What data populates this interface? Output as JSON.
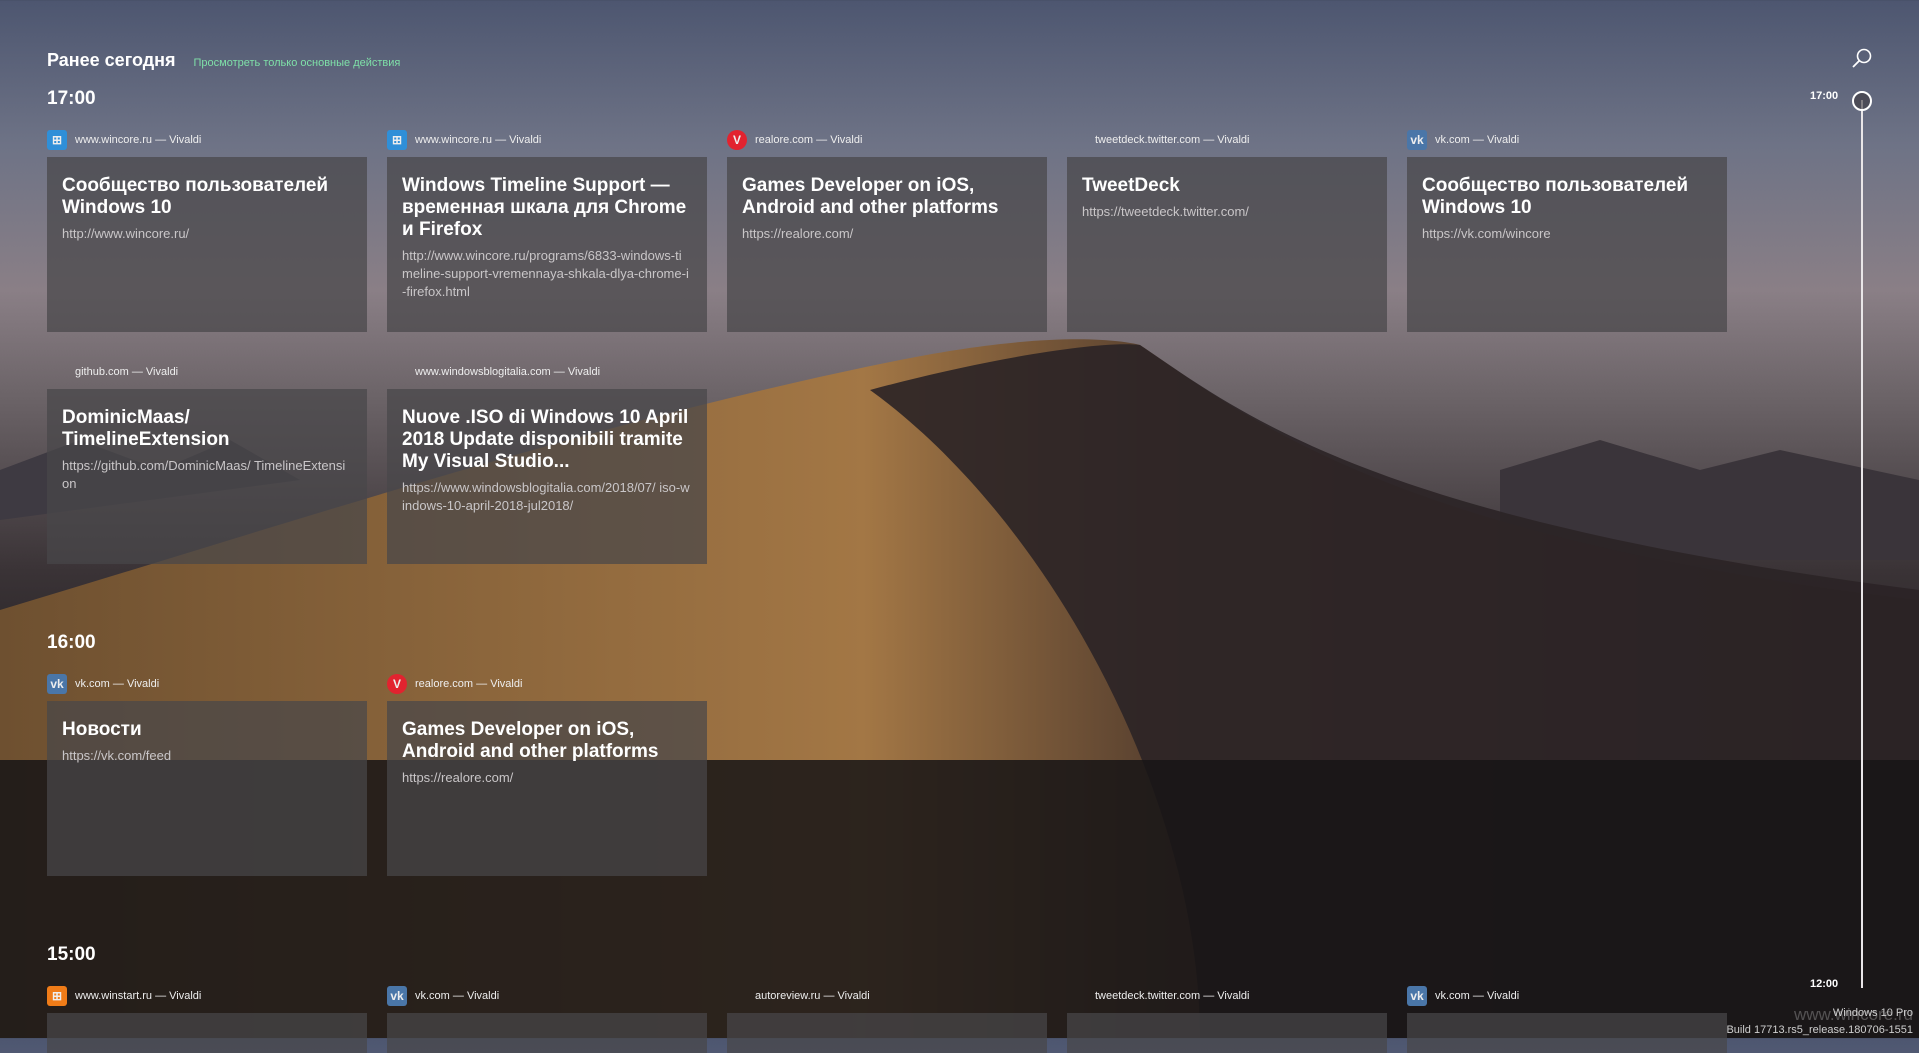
{
  "header": {
    "title": "Ранее сегодня",
    "filter_link": "Просмотреть только основные действия"
  },
  "sections": [
    {
      "time": "17:00"
    },
    {
      "time": "16:00"
    },
    {
      "time": "15:00"
    }
  ],
  "cards": [
    {
      "source": "www.wincore.ru — Vivaldi",
      "icon": "windows-grid-icon",
      "title": "Сообщество пользователей Windows 10",
      "url": "http://www.wincore.ru/"
    },
    {
      "source": "www.wincore.ru — Vivaldi",
      "icon": "windows-grid-icon",
      "title": "Windows Timeline Support — временная шкала для Chrome и Firefox",
      "url": "http://www.wincore.ru/programs/6833-windows-timeline-support-vremennaya-shkala-dlya-chrome-i-firefox.html"
    },
    {
      "source": "realore.com — Vivaldi",
      "icon": "vivaldi-icon",
      "title": "Games Developer on iOS, Android and other platforms",
      "url": "https://realore.com/"
    },
    {
      "source": "tweetdeck.twitter.com — Vivaldi",
      "icon": "blank-icon",
      "title": "TweetDeck",
      "url": "https://tweetdeck.twitter.com/"
    },
    {
      "source": "vk.com — Vivaldi",
      "icon": "vk-icon",
      "title": "Сообщество пользователей Windows 10",
      "url": "https://vk.com/wincore"
    },
    {
      "source": "github.com — Vivaldi",
      "icon": "blank-icon",
      "title": "DominicMaas/ TimelineExtension",
      "url": "https://github.com/DominicMaas/ TimelineExtension"
    },
    {
      "source": "www.windowsblogitalia.com — Vivaldi",
      "icon": "blank-icon",
      "title": "Nuove .ISO di Windows 10 April 2018 Update disponibili tramite My Visual Studio...",
      "url": "https://www.windowsblogitalia.com/2018/07/ iso-windows-10-april-2018-jul2018/"
    },
    {
      "source": "vk.com — Vivaldi",
      "icon": "vk-icon",
      "title": "Новости",
      "url": "https://vk.com/feed"
    },
    {
      "source": "realore.com — Vivaldi",
      "icon": "vivaldi-icon",
      "title": "Games Developer on iOS, Android and other platforms",
      "url": "https://realore.com/"
    },
    {
      "source": "www.winstart.ru — Vivaldi",
      "icon": "winstart-icon",
      "title": "",
      "url": ""
    },
    {
      "source": "vk.com — Vivaldi",
      "icon": "vk-icon",
      "title": "",
      "url": ""
    },
    {
      "source": "autoreview.ru — Vivaldi",
      "icon": "blank-icon",
      "title": "",
      "url": ""
    },
    {
      "source": "tweetdeck.twitter.com — Vivaldi",
      "icon": "blank-icon",
      "title": "",
      "url": ""
    },
    {
      "source": "vk.com — Vivaldi",
      "icon": "vk-icon",
      "title": "",
      "url": ""
    }
  ],
  "timeline": {
    "top_label": "17:00",
    "bottom_label": "12:00"
  },
  "watermark": {
    "edition": "Windows 10 Pro",
    "build": "Build 17713.rs5_release.180706-1551",
    "site": "www.wincore.ru"
  },
  "colors": {
    "link": "#7fe0a8",
    "windows-grid-icon": "#2f8fd8",
    "vivaldi-icon": "#e2232f",
    "vk-icon": "#4a76a8",
    "winstart-icon": "#f07c18"
  }
}
